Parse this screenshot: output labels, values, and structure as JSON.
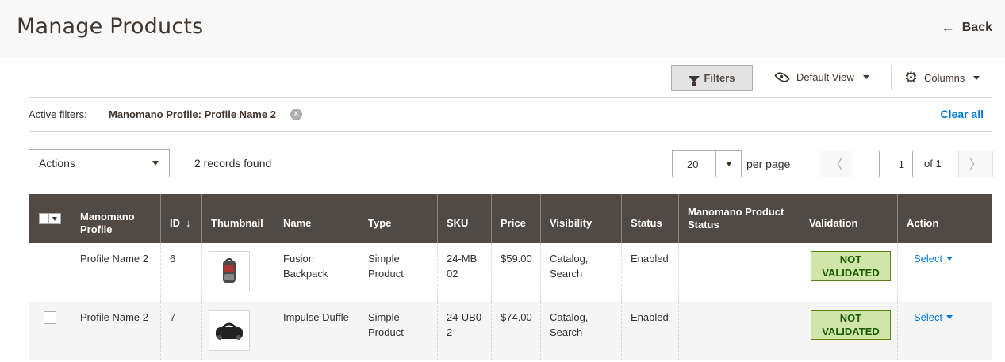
{
  "header": {
    "title": "Manage Products",
    "back_label": "Back"
  },
  "toolbar": {
    "filters_label": "Filters",
    "view_label": "Default View",
    "columns_label": "Columns"
  },
  "active_filters": {
    "label": "Active filters:",
    "value": "Manomano Profile: Profile Name 2",
    "clear_label": "Clear all"
  },
  "controls": {
    "actions_label": "Actions",
    "records_text": "2 records found",
    "per_page_value": "20",
    "per_page_label": "per page",
    "page_value": "1",
    "page_of": "of 1"
  },
  "columns": [
    "Manomano Profile",
    "ID",
    "Thumbnail",
    "Name",
    "Type",
    "SKU",
    "Price",
    "Visibility",
    "Status",
    "Manomano Product Status",
    "Validation",
    "Action"
  ],
  "rows": [
    {
      "profile": "Profile Name 2",
      "id": "6",
      "name": "Fusion Backpack",
      "type": "Simple Product",
      "sku": "24-MB02",
      "price": "$59.00",
      "visibility": "Catalog, Search",
      "status": "Enabled",
      "mm_status": "",
      "validation": "NOT VALIDATED",
      "action": "Select"
    },
    {
      "profile": "Profile Name 2",
      "id": "7",
      "name": "Impulse Duffle",
      "type": "Simple Product",
      "sku": "24-UB02",
      "price": "$74.00",
      "visibility": "Catalog, Search",
      "status": "Enabled",
      "mm_status": "",
      "validation": "NOT VALIDATED",
      "action": "Select"
    }
  ],
  "colors": {
    "header_bg": "#514943",
    "link": "#007bdb",
    "badge_bg": "#d0e5a9",
    "badge_text": "#185b00"
  }
}
